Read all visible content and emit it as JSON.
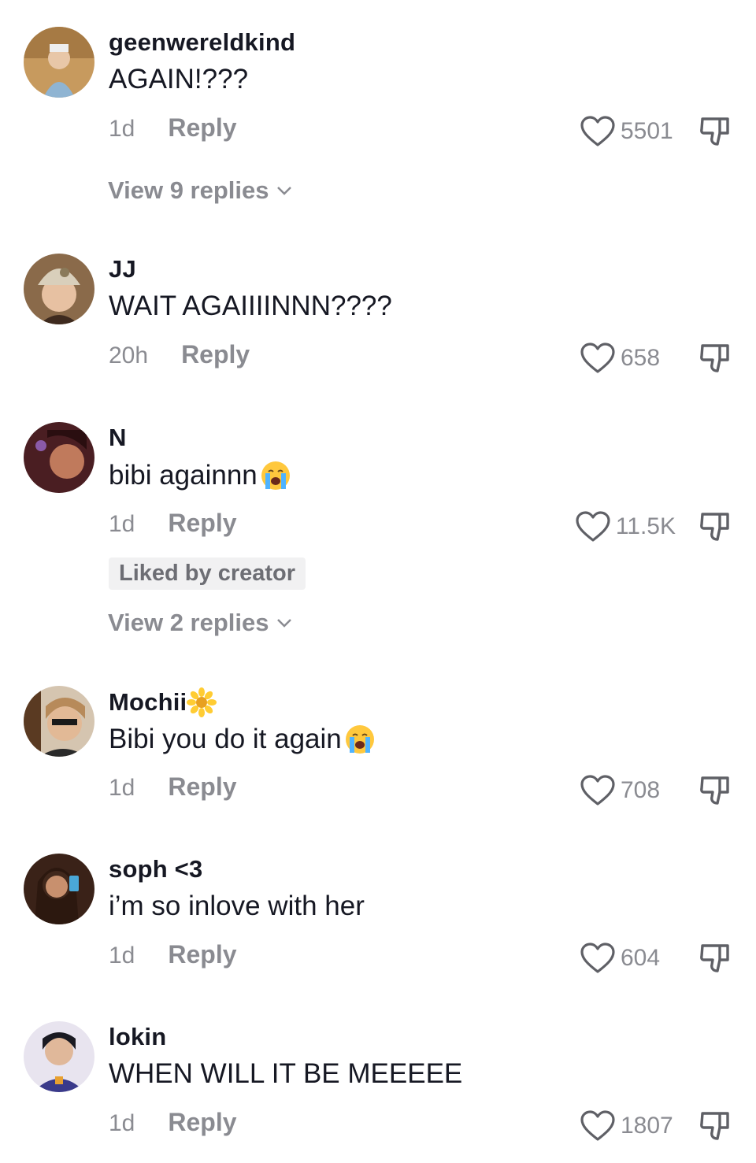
{
  "comments": [
    {
      "username": "geenwereldkind",
      "text": "AGAIN!???",
      "time": "1d",
      "reply_label": "Reply",
      "likes": "5501",
      "view_replies": "View 9 replies",
      "avatar_colors": [
        "#c9a06a",
        "#7ba5c4"
      ]
    },
    {
      "username": "JJ",
      "text": "WAIT AGAIIIINNN????",
      "time": "20h",
      "reply_label": "Reply",
      "likes": "658",
      "avatar_colors": [
        "#d8cdb8",
        "#8a6a4a"
      ]
    },
    {
      "username": "N",
      "text": "bibi againnn",
      "emoji": "crying-face",
      "time": "1d",
      "reply_label": "Reply",
      "likes": "11.5K",
      "liked_by_creator": "Liked by creator",
      "view_replies": "View 2 replies",
      "avatar_colors": [
        "#5a2a2a",
        "#c27a5a"
      ]
    },
    {
      "username": "Mochii",
      "username_emoji": "sunflower",
      "text": "Bibi you do it again",
      "emoji": "crying-face",
      "time": "1d",
      "reply_label": "Reply",
      "likes": "708",
      "avatar_colors": [
        "#b99a7a",
        "#3a2a1a"
      ]
    },
    {
      "username": "soph <3",
      "text": "i’m so inlove with her",
      "time": "1d",
      "reply_label": "Reply",
      "likes": "604",
      "avatar_colors": [
        "#4a2a1a",
        "#b58a6a"
      ]
    },
    {
      "username": "lokin",
      "text": "WHEN WILL IT BE MEEEEE",
      "time": "1d",
      "reply_label": "Reply",
      "likes": "1807",
      "avatar_colors": [
        "#2a2a4a",
        "#d8b89a"
      ]
    }
  ]
}
